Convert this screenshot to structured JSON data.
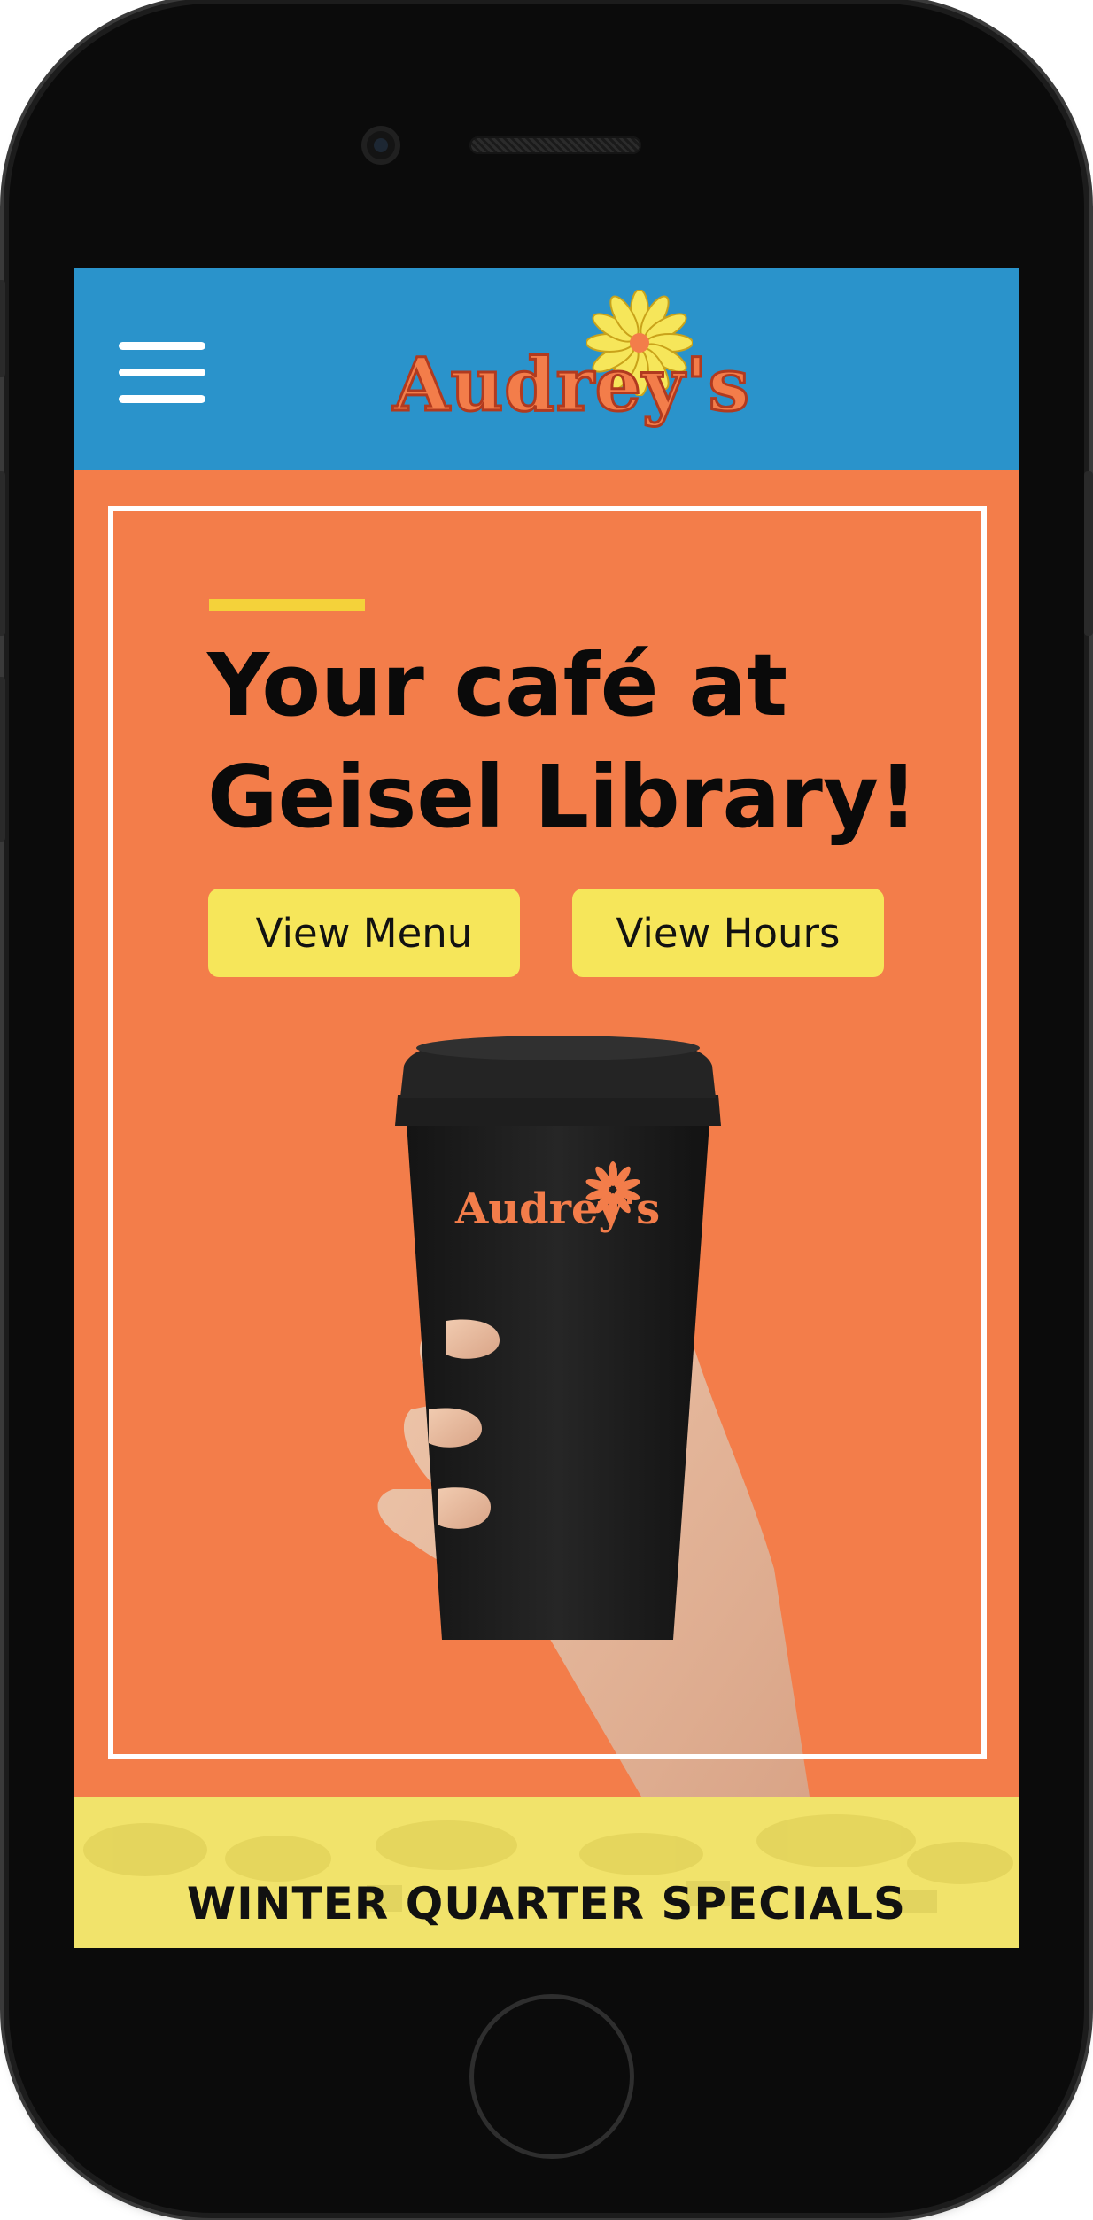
{
  "header": {
    "brand": "Audrey's",
    "menu_icon": "hamburger-menu-icon",
    "background_color": "#2a93cb"
  },
  "hero": {
    "headline_line1": "Your café at",
    "headline_line2": "Geisel Library!",
    "buttons": [
      {
        "label": "View Menu"
      },
      {
        "label": "View Hours"
      }
    ],
    "cup_logo_text": "Audrey's",
    "background_color": "#f37d4a",
    "accent_color": "#f4d23a",
    "button_color": "#f6e65a"
  },
  "specials": {
    "title": "WINTER QUARTER SPECIALS",
    "background_color": "#f1e36b"
  }
}
